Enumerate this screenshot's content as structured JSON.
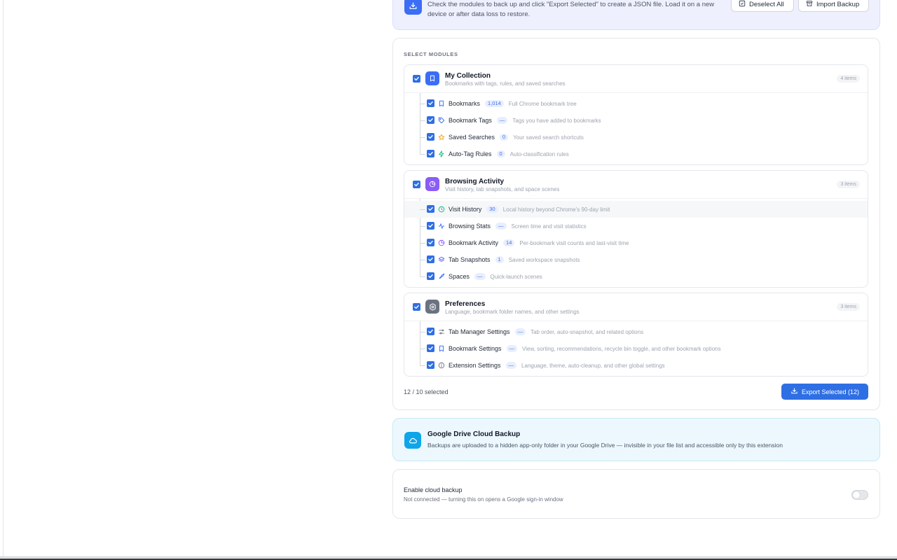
{
  "banner": {
    "text": "Check the modules to back up and click \"Export Selected\" to create a JSON file. Load it on a new device or after data loss to restore.",
    "deselect_label": "Deselect All",
    "import_label": "Import Backup"
  },
  "modules": {
    "section_title": "SELECT MODULES",
    "groups": [
      {
        "title": "My Collection",
        "desc": "Bookmarks with tags, rules, and saved searches",
        "badge": "4 items",
        "icon": "bookmark-icon",
        "color": "#3b6ef5",
        "items": [
          {
            "label": "Bookmarks",
            "count": "1,014",
            "desc": "Full Chrome bookmark tree",
            "icon": "bookmark-icon"
          },
          {
            "label": "Bookmark Tags",
            "count": "—",
            "desc": "Tags you have added to bookmarks",
            "icon": "tag-icon"
          },
          {
            "label": "Saved Searches",
            "count": "0",
            "desc": "Your saved search shortcuts",
            "icon": "star-icon"
          },
          {
            "label": "Auto-Tag Rules",
            "count": "0",
            "desc": "Auto-classification rules",
            "icon": "lightning-icon"
          }
        ]
      },
      {
        "title": "Browsing Activity",
        "desc": "Visit history, tab snapshots, and space scenes",
        "badge": "3 items",
        "icon": "pie-chart-icon",
        "color": "#8b5cf6",
        "items": [
          {
            "label": "Visit History",
            "count": "30",
            "desc": "Local history beyond Chrome's 90-day limit",
            "icon": "clock-icon"
          },
          {
            "label": "Browsing Stats",
            "count": "—",
            "desc": "Screen time and visit statistics",
            "icon": "activity-icon"
          },
          {
            "label": "Bookmark Activity",
            "count": "14",
            "desc": "Per-bookmark visit counts and last-visit time",
            "icon": "pie-chart-icon"
          },
          {
            "label": "Tab Snapshots",
            "count": "1",
            "desc": "Saved workspace snapshots",
            "icon": "layers-icon"
          },
          {
            "label": "Spaces",
            "count": "—",
            "desc": "Quick-launch scenes",
            "icon": "rocket-icon"
          }
        ]
      },
      {
        "title": "Preferences",
        "desc": "Language, bookmark folder names, and other settings",
        "badge": "3 items",
        "icon": "settings-icon",
        "color": "#6b7280",
        "items": [
          {
            "label": "Tab Manager Settings",
            "count": "—",
            "desc": "Tab order, auto-snapshot, and related options",
            "icon": "sliders-icon"
          },
          {
            "label": "Bookmark Settings",
            "count": "—",
            "desc": "View, sorting, recommendations, recycle bin toggle, and other bookmark options",
            "icon": "bookmark-icon"
          },
          {
            "label": "Extension Settings",
            "count": "—",
            "desc": "Language, theme, auto-cleanup, and other global settings",
            "icon": "info-icon"
          }
        ]
      }
    ],
    "selected_text": "12 / 10 selected",
    "export_label": "Export Selected (12)"
  },
  "cloud": {
    "title": "Google Drive Cloud Backup",
    "desc": "Backups are uploaded to a hidden app-only folder in your Google Drive — invisible in your file list and accessible only by this extension",
    "toggle_title": "Enable cloud backup",
    "toggle_desc": "Not connected — turning this on opens a Google sign-in window",
    "enabled": false
  },
  "colors": {
    "accent": "#2f6fe4",
    "cloud": "#0ea5e9"
  }
}
